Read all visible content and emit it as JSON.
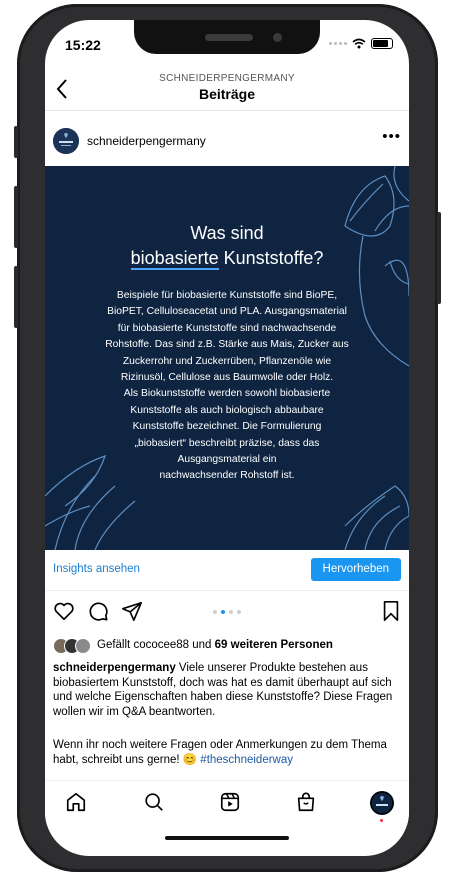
{
  "status": {
    "time": "15:22"
  },
  "header": {
    "account": "SCHNEIDERPENGERMANY",
    "title": "Beiträge"
  },
  "post": {
    "username": "schneiderpengermany",
    "more": "•••",
    "image": {
      "title_line1": "Was sind",
      "title_underlined": "biobasierte",
      "title_rest": " Kunststoffe?",
      "body": [
        "Beispiele für biobasierte Kunststoffe sind BioPE,",
        "BioPET, Celluloseacetat und PLA. Ausgangsmaterial",
        "für biobasierte Kunststoffe sind nachwachsende",
        "Rohstoffe. Das sind z.B. Stärke aus Mais, Zucker aus",
        "Zuckerrohr und Zuckerrüben, Pflanzenöle wie",
        "Rizinusöl, Cellulose aus Baumwolle oder Holz.",
        "Als Biokunststoffe werden sowohl biobasierte",
        "Kunststoffe als auch biologisch abbaubare",
        "Kunststoffe bezeichnet. Die Formulierung",
        "„biobasiert“ beschreibt präzise, dass das",
        "Ausgangsmaterial ein",
        "nachwachsender Rohstoff ist."
      ]
    },
    "insights_label": "Insights ansehen",
    "highlight_label": "Hervorheben",
    "carousel": {
      "count": 4,
      "active": 1
    },
    "likes": {
      "prefix": "Gefällt ",
      "user": "cococee88",
      "middle": " und ",
      "others": "69 weiteren Personen"
    },
    "caption": {
      "username": "schneiderpengermany",
      "text": " Viele unserer Produkte bestehen aus biobasiertem Kunststoff, doch was hat es damit überhaupt auf sich und welche Eigenschaften haben diese Kunststoffe? Diese Fragen wollen wir im Q&A beantworten.",
      "text2": "Wenn ihr noch weitere Fragen oder Anmerkungen zu dem Thema habt, schreibt uns gerne! 😊 ",
      "hashtag": "#theschneiderway"
    }
  },
  "icons": [
    "back-chevron-icon",
    "heart-icon",
    "comment-icon",
    "send-icon",
    "bookmark-icon",
    "home-icon",
    "search-icon",
    "reels-icon",
    "shop-icon",
    "profile-icon"
  ],
  "colors": {
    "image_bg": "#0e2440",
    "accent": "#1a95f0",
    "link": "#1a7fd4",
    "underline": "#4ea3ff"
  }
}
